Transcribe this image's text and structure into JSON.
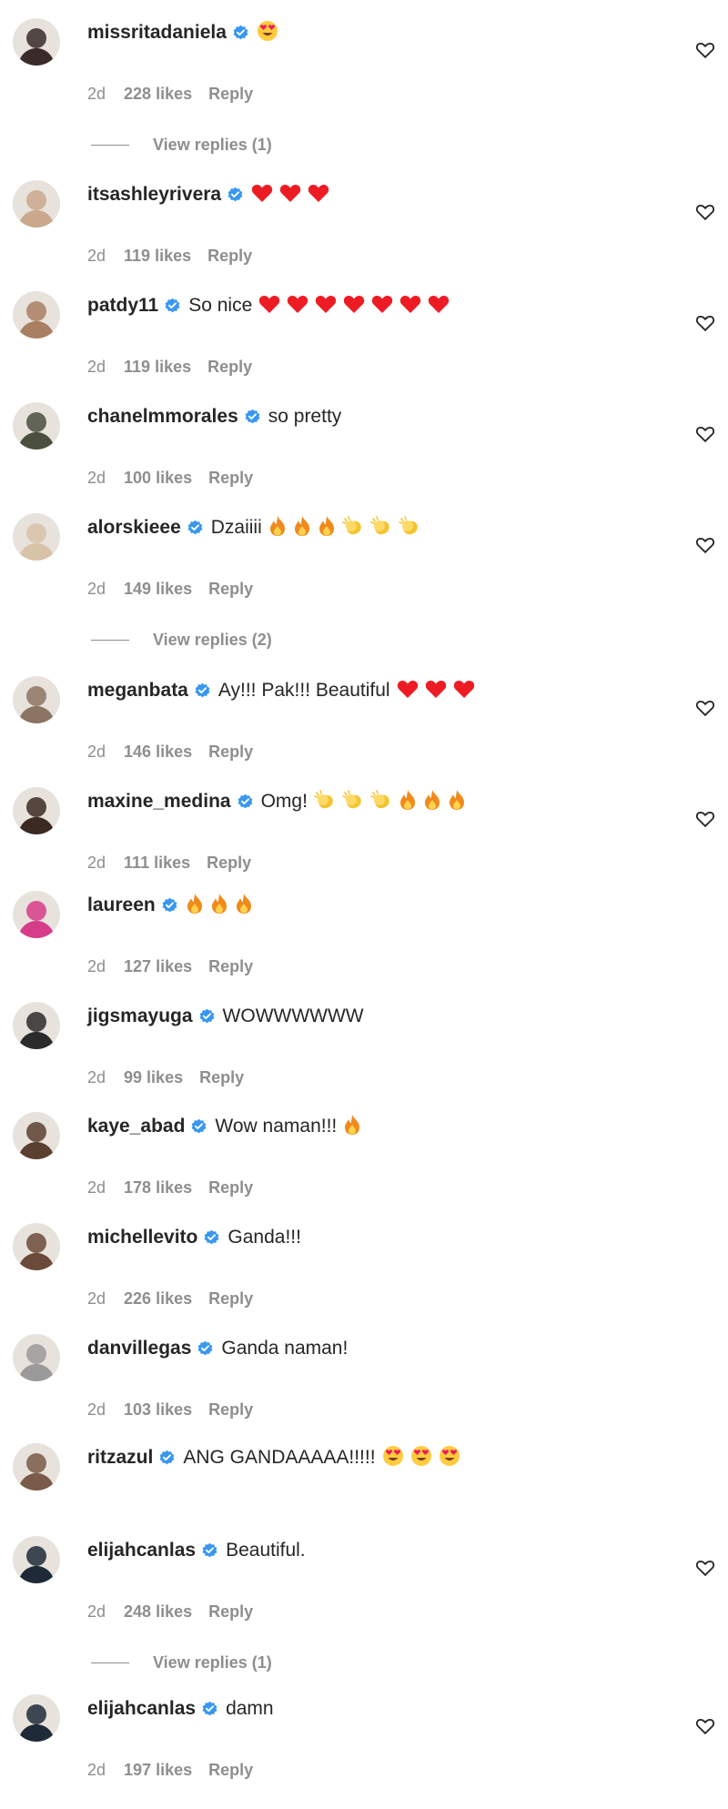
{
  "comments": [
    {
      "username": "missritadaniela",
      "text": "",
      "emojis": [
        "love"
      ],
      "time": "2d",
      "likes": "228 likes",
      "reply": "Reply",
      "view_replies": "View replies (1)",
      "avatar": "#3a2a2a"
    },
    {
      "username": "itsashleyrivera",
      "text": "",
      "emojis": [
        "heart",
        "heart",
        "heart"
      ],
      "time": "2d",
      "likes": "119 likes",
      "reply": "Reply",
      "avatar": "#c9a88c"
    },
    {
      "username": "patdy11",
      "text": "So nice",
      "emojis": [
        "heart",
        "heart",
        "heart",
        "heart",
        "heart",
        "heart",
        "heart"
      ],
      "time": "2d",
      "likes": "119 likes",
      "reply": "Reply",
      "avatar": "#a97f63"
    },
    {
      "username": "chanelmmorales",
      "text": "so pretty",
      "emojis": [],
      "time": "2d",
      "likes": "100 likes",
      "reply": "Reply",
      "avatar": "#4a4f3e"
    },
    {
      "username": "alorskieee",
      "text": "Dzaiiii",
      "emojis": [
        "fire",
        "fire",
        "fire",
        "clap",
        "clap",
        "clap"
      ],
      "time": "2d",
      "likes": "149 likes",
      "reply": "Reply",
      "view_replies": "View replies (2)",
      "avatar": "#d8c2a8"
    },
    {
      "username": "meganbata",
      "text": "Ay!!! Pak!!! Beautiful",
      "emojis": [
        "heart",
        "heart",
        "heart"
      ],
      "time": "2d",
      "likes": "146 likes",
      "reply": "Reply",
      "avatar": "#8c7464"
    },
    {
      "username": "maxine_medina",
      "text": "Omg!",
      "emojis": [
        "clap",
        "clap",
        "clap",
        "fire",
        "fire",
        "fire"
      ],
      "time": "2d",
      "likes": "111 likes",
      "reply": "Reply",
      "avatar": "#3b2a22"
    },
    {
      "username": "laureen",
      "text": "",
      "emojis": [
        "fire",
        "fire",
        "fire"
      ],
      "time": "2d",
      "likes": "127 likes",
      "reply": "Reply",
      "avatar": "#d63c8a"
    },
    {
      "username": "jigsmayuga",
      "text": "WOWWWWWW",
      "emojis": [],
      "time": "2d",
      "likes": "99 likes",
      "reply": "Reply",
      "avatar": "#2b2b2b"
    },
    {
      "username": "kaye_abad",
      "text": "Wow naman!!!",
      "emojis": [
        "fire"
      ],
      "time": "2d",
      "likes": "178 likes",
      "reply": "Reply",
      "avatar": "#5a4030"
    },
    {
      "username": "michellevito",
      "text": "Ganda!!!",
      "emojis": [],
      "time": "2d",
      "likes": "226 likes",
      "reply": "Reply",
      "avatar": "#6b4a3a"
    },
    {
      "username": "danvillegas",
      "text": "Ganda naman!",
      "emojis": [],
      "time": "2d",
      "likes": "103 likes",
      "reply": "Reply",
      "avatar": "#9a9a9a"
    },
    {
      "username": "ritzazul",
      "text": "ANG GANDAAAAA!!!!!",
      "emojis": [
        "love",
        "love",
        "love"
      ],
      "time": "",
      "likes": "",
      "reply": "",
      "avatar": "#7a5a48"
    },
    {
      "username": "elijahcanlas",
      "text": "Beautiful.",
      "emojis": [],
      "time": "2d",
      "likes": "248 likes",
      "reply": "Reply",
      "view_replies": "View replies (1)",
      "avatar": "#1e2a38"
    },
    {
      "username": "elijahcanlas",
      "text": "damn",
      "emojis": [],
      "time": "2d",
      "likes": "197 likes",
      "reply": "Reply",
      "avatar": "#1e2a38"
    }
  ],
  "colors": {
    "verified": "#3897f0",
    "heart": "#ed1c24",
    "fire": "#f08a1c",
    "clap": "#f4c430",
    "muted": "#8e8e8e"
  },
  "icons": {
    "verified": "verified-badge-icon",
    "like": "heart-outline-icon",
    "heart": "red-heart-emoji",
    "fire": "fire-emoji",
    "clap": "clapping-hands-emoji",
    "love": "heart-eyes-emoji"
  }
}
